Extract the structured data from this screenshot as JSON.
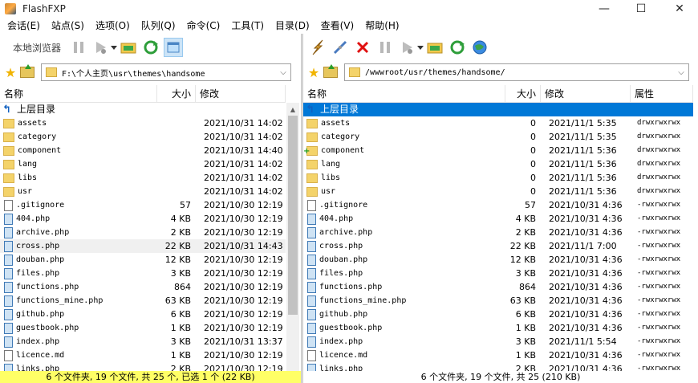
{
  "window": {
    "title": "FlashFXP",
    "minimize": "—",
    "maximize": "☐",
    "close": "✕"
  },
  "menu": [
    "会话(E)",
    "站点(S)",
    "选项(O)",
    "队列(Q)",
    "命令(C)",
    "工具(T)",
    "目录(D)",
    "查看(V)",
    "帮助(H)"
  ],
  "left": {
    "toolbar_label": "本地浏览器",
    "path": "F:\\个人主页\\usr\\themes\\handsome",
    "columns": [
      "名称",
      "大小",
      "修改"
    ],
    "rows": [
      {
        "name": "上层目录",
        "type": "up",
        "size": "",
        "date": ""
      },
      {
        "name": "assets",
        "type": "folder",
        "size": "",
        "date": "2021/10/31 14:02"
      },
      {
        "name": "category",
        "type": "folder",
        "size": "",
        "date": "2021/10/31 14:02"
      },
      {
        "name": "component",
        "type": "folder",
        "size": "",
        "date": "2021/10/31 14:40"
      },
      {
        "name": "lang",
        "type": "folder",
        "size": "",
        "date": "2021/10/31 14:02"
      },
      {
        "name": "libs",
        "type": "folder",
        "size": "",
        "date": "2021/10/31 14:02"
      },
      {
        "name": "usr",
        "type": "folder",
        "size": "",
        "date": "2021/10/31 14:02"
      },
      {
        "name": ".gitignore",
        "type": "file",
        "size": "57",
        "date": "2021/10/30 12:19"
      },
      {
        "name": "404.php",
        "type": "php",
        "size": "4 KB",
        "date": "2021/10/30 12:19"
      },
      {
        "name": "archive.php",
        "type": "php",
        "size": "2 KB",
        "date": "2021/10/30 12:19"
      },
      {
        "name": "cross.php",
        "type": "php",
        "size": "22 KB",
        "date": "2021/10/31 14:43"
      },
      {
        "name": "douban.php",
        "type": "php",
        "size": "12 KB",
        "date": "2021/10/30 12:19"
      },
      {
        "name": "files.php",
        "type": "php",
        "size": "3 KB",
        "date": "2021/10/30 12:19"
      },
      {
        "name": "functions.php",
        "type": "php",
        "size": "864",
        "date": "2021/10/30 12:19"
      },
      {
        "name": "functions_mine.php",
        "type": "php",
        "size": "63 KB",
        "date": "2021/10/30 12:19"
      },
      {
        "name": "github.php",
        "type": "php",
        "size": "6 KB",
        "date": "2021/10/30 12:19"
      },
      {
        "name": "guestbook.php",
        "type": "php",
        "size": "1 KB",
        "date": "2021/10/30 12:19"
      },
      {
        "name": "index.php",
        "type": "php",
        "size": "3 KB",
        "date": "2021/10/31 13:37"
      },
      {
        "name": "licence.md",
        "type": "file",
        "size": "1 KB",
        "date": "2021/10/30 12:19"
      },
      {
        "name": "links.php",
        "type": "php",
        "size": "2 KB",
        "date": "2021/10/30 12:19"
      }
    ],
    "status": "6 个文件夹, 19 个文件, 共 25 个, 已选 1 个 (22 KB)"
  },
  "right": {
    "path": "/wwwroot/usr/themes/handsome/",
    "columns": [
      "名称",
      "大小",
      "修改",
      "属性"
    ],
    "rows": [
      {
        "name": "上层目录",
        "type": "up",
        "size": "",
        "date": "",
        "attr": ""
      },
      {
        "name": "assets",
        "type": "folder",
        "size": "0",
        "date": "2021/11/1 5:35",
        "attr": "drwxrwxrwx"
      },
      {
        "name": "category",
        "type": "folder",
        "size": "0",
        "date": "2021/11/1 5:35",
        "attr": "drwxrwxrwx"
      },
      {
        "name": "component",
        "type": "folder-plus",
        "size": "0",
        "date": "2021/11/1 5:36",
        "attr": "drwxrwxrwx"
      },
      {
        "name": "lang",
        "type": "folder",
        "size": "0",
        "date": "2021/11/1 5:36",
        "attr": "drwxrwxrwx"
      },
      {
        "name": "libs",
        "type": "folder",
        "size": "0",
        "date": "2021/11/1 5:36",
        "attr": "drwxrwxrwx"
      },
      {
        "name": "usr",
        "type": "folder",
        "size": "0",
        "date": "2021/11/1 5:36",
        "attr": "drwxrwxrwx"
      },
      {
        "name": ".gitignore",
        "type": "file",
        "size": "57",
        "date": "2021/10/31 4:36",
        "attr": "-rwxrwxrwx"
      },
      {
        "name": "404.php",
        "type": "php",
        "size": "4 KB",
        "date": "2021/10/31 4:36",
        "attr": "-rwxrwxrwx"
      },
      {
        "name": "archive.php",
        "type": "php",
        "size": "2 KB",
        "date": "2021/10/31 4:36",
        "attr": "-rwxrwxrwx"
      },
      {
        "name": "cross.php",
        "type": "php",
        "size": "22 KB",
        "date": "2021/11/1 7:00",
        "attr": "-rwxrwxrwx"
      },
      {
        "name": "douban.php",
        "type": "php",
        "size": "12 KB",
        "date": "2021/10/31 4:36",
        "attr": "-rwxrwxrwx"
      },
      {
        "name": "files.php",
        "type": "php",
        "size": "3 KB",
        "date": "2021/10/31 4:36",
        "attr": "-rwxrwxrwx"
      },
      {
        "name": "functions.php",
        "type": "php",
        "size": "864",
        "date": "2021/10/31 4:36",
        "attr": "-rwxrwxrwx"
      },
      {
        "name": "functions_mine.php",
        "type": "php",
        "size": "63 KB",
        "date": "2021/10/31 4:36",
        "attr": "-rwxrwxrwx"
      },
      {
        "name": "github.php",
        "type": "php",
        "size": "6 KB",
        "date": "2021/10/31 4:36",
        "attr": "-rwxrwxrwx"
      },
      {
        "name": "guestbook.php",
        "type": "php",
        "size": "1 KB",
        "date": "2021/10/31 4:36",
        "attr": "-rwxrwxrwx"
      },
      {
        "name": "index.php",
        "type": "php",
        "size": "3 KB",
        "date": "2021/11/1 5:54",
        "attr": "-rwxrwxrwx"
      },
      {
        "name": "licence.md",
        "type": "file",
        "size": "1 KB",
        "date": "2021/10/31 4:36",
        "attr": "-rwxrwxrwx"
      },
      {
        "name": "links.php",
        "type": "php",
        "size": "2 KB",
        "date": "2021/10/31 4:36",
        "attr": "-rwxrwxrwx"
      }
    ],
    "status": "6 个文件夹, 19 个文件, 共 25 (210 KB)"
  },
  "colors": {
    "selection": "#0078d7",
    "status_left": "#ffff66",
    "accent_star": "#f1b400"
  }
}
